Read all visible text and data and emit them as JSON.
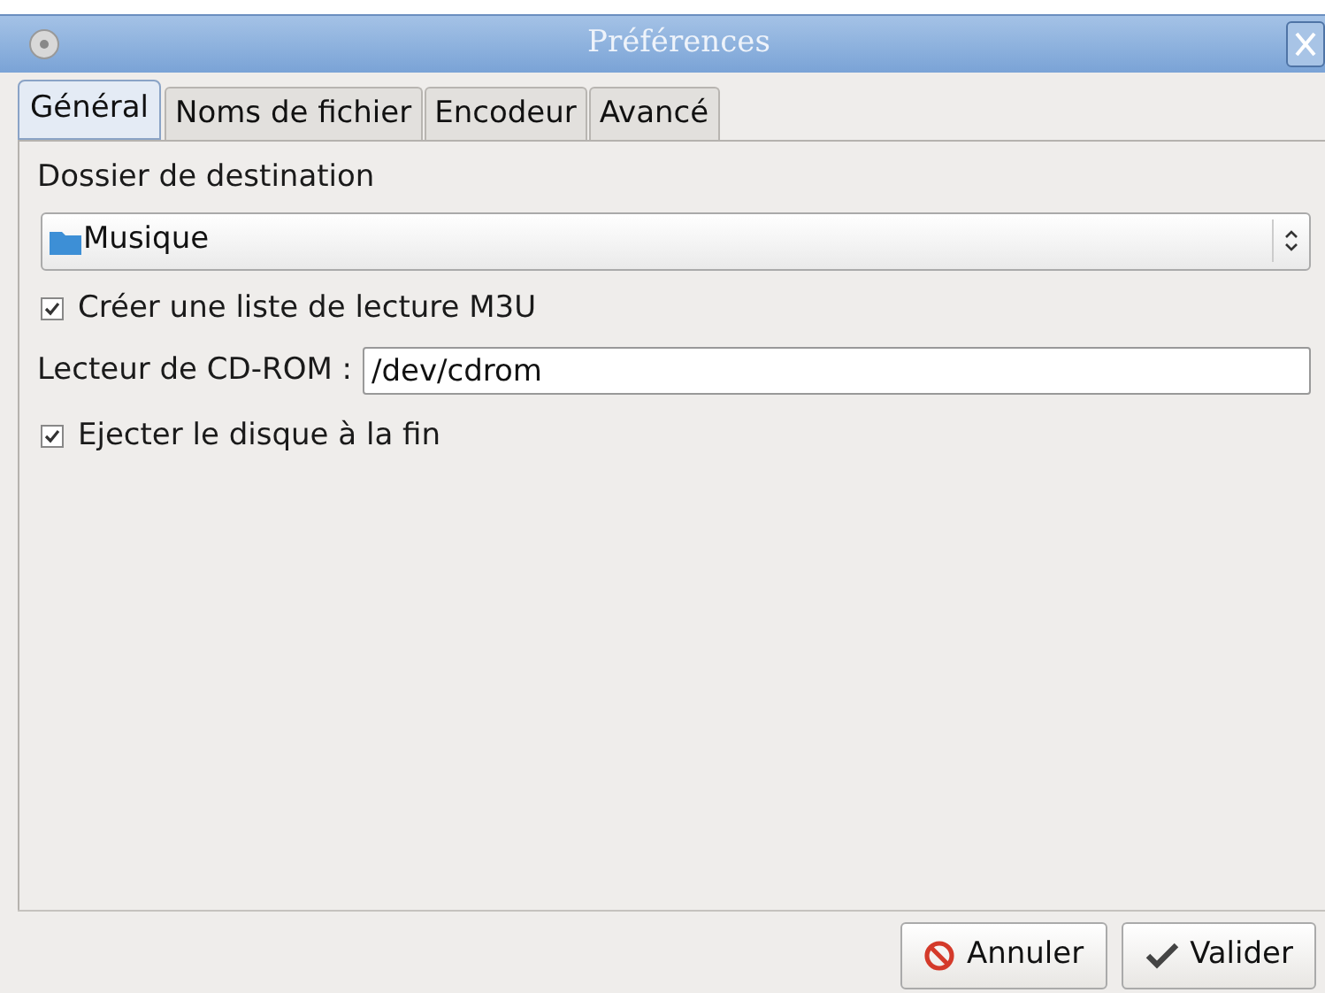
{
  "window": {
    "title": "Préférences"
  },
  "tabs": [
    {
      "label": "Général",
      "selected": true
    },
    {
      "label": "Noms de fichier",
      "selected": false
    },
    {
      "label": "Encodeur",
      "selected": false
    },
    {
      "label": "Avancé",
      "selected": false
    }
  ],
  "destination": {
    "label": "Dossier de destination",
    "value": "Musique"
  },
  "playlist": {
    "label": "Créer une liste de lecture M3U",
    "checked": true
  },
  "cdrom": {
    "label": "Lecteur de CD-ROM :",
    "value": "/dev/cdrom"
  },
  "eject": {
    "label": "Ejecter le disque à la fin",
    "checked": true
  },
  "buttons": [
    {
      "kind": "cancel",
      "label": "Annuler"
    },
    {
      "kind": "ok",
      "label": "Valider"
    }
  ]
}
